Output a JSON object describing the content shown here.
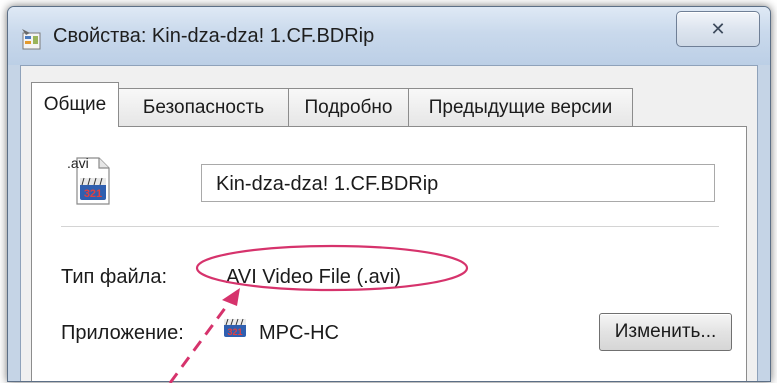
{
  "window": {
    "title": "Свойства: Kin-dza-dza! 1.CF.BDRip",
    "close_label": "✕"
  },
  "tabs": [
    {
      "label": "Общие",
      "active": true
    },
    {
      "label": "Безопасность",
      "active": false
    },
    {
      "label": "Подробно",
      "active": false
    },
    {
      "label": "Предыдущие версии",
      "active": false
    }
  ],
  "general": {
    "file_icon_ext": ".avi",
    "file_icon_badge": "321",
    "file_name": "Kin-dza-dza! 1.CF.BDRip",
    "file_type_label": "Тип файла:",
    "file_type_value": "AVI Video File (.avi)",
    "app_label": "Приложение:",
    "app_value": "MPC-HC",
    "change_button": "Изменить..."
  },
  "colors": {
    "annotation": "#d6336c",
    "titlebar": "#c9d9ec"
  }
}
